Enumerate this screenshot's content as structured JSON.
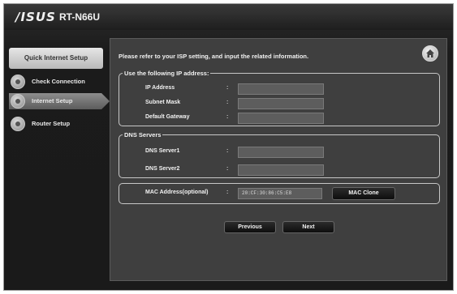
{
  "header": {
    "brand": "/ISUS",
    "model": "RT-N66U"
  },
  "sidebar": {
    "title": "Quick Internet Setup",
    "items": [
      {
        "label": "Check Connection",
        "active": false
      },
      {
        "label": "Internet Setup",
        "active": true
      },
      {
        "label": "Router Setup",
        "active": false
      }
    ]
  },
  "main": {
    "instruction": "Please refer to your ISP setting, and input the related information.",
    "home_icon": "home-icon",
    "ip_section": {
      "legend": "Use the following IP address:",
      "fields": [
        {
          "label": "IP Address",
          "colon": ":",
          "value": ""
        },
        {
          "label": "Subnet Mask",
          "colon": ":",
          "value": ""
        },
        {
          "label": "Default Gateway",
          "colon": ":",
          "value": ""
        }
      ]
    },
    "dns_section": {
      "legend": "DNS Servers",
      "fields": [
        {
          "label": "DNS Server1",
          "colon": ":",
          "value": ""
        },
        {
          "label": "DNS Server2",
          "colon": ":",
          "value": ""
        }
      ]
    },
    "mac_section": {
      "label": "MAC Address(optional)",
      "colon": ":",
      "value": "20:CF:30:86:C5:E8",
      "clone_button": "MAC Clone"
    },
    "buttons": {
      "previous": "Previous",
      "next": "Next"
    }
  }
}
